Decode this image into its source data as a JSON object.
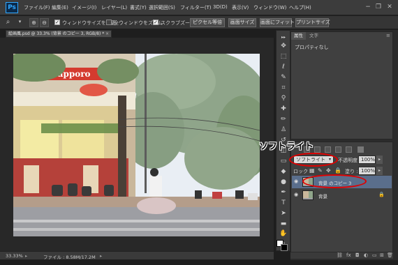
{
  "app": {
    "logo": "Ps"
  },
  "menu": [
    "ファイル(F)",
    "編集(E)",
    "イメージ(I)",
    "レイヤー(L)",
    "書式(Y)",
    "選択範囲(S)",
    "フィルター(T)",
    "3D(D)",
    "表示(V)",
    "ウィンドウ(W)",
    "ヘルプ(H)"
  ],
  "window_controls": {
    "minimize": "−",
    "restore": "❐",
    "close": "✕"
  },
  "options": {
    "resize_windows": "ウィンドウサイズを変更",
    "zoom_all": "全ウィンドウをズーム",
    "scrubby_zoom": "スクラブズーム",
    "btn_pixel": "ピクセル等倍",
    "btn_screen": "画面サイズ",
    "btn_fit": "画面にフィット",
    "btn_print": "プリントサイズ"
  },
  "document": {
    "tab_title": "絵画風.psd @ 33.3% (背景 のコピー 3, RGB/8) *",
    "close": "×"
  },
  "status": {
    "zoom": "33.33%",
    "file_info": "ファイル : 8.58M/17.2M"
  },
  "properties": {
    "tab1": "属性",
    "tab2": "文字",
    "content": "プロパティなし"
  },
  "annotation": {
    "text": "ソフトライト",
    "color": "#e00000"
  },
  "layers": {
    "blend_mode": "ソフトライト",
    "opacity_label": "不透明度 :",
    "opacity_value": "100%",
    "lock_label": "ロック :",
    "fill_label": "塗り :",
    "fill_value": "100%",
    "items": [
      {
        "name": "背景 のコピー 3",
        "selected": true
      },
      {
        "name": "背景",
        "selected": false
      }
    ]
  },
  "colors": {
    "accent": "#31a8ff",
    "highlight": "#e00000"
  }
}
